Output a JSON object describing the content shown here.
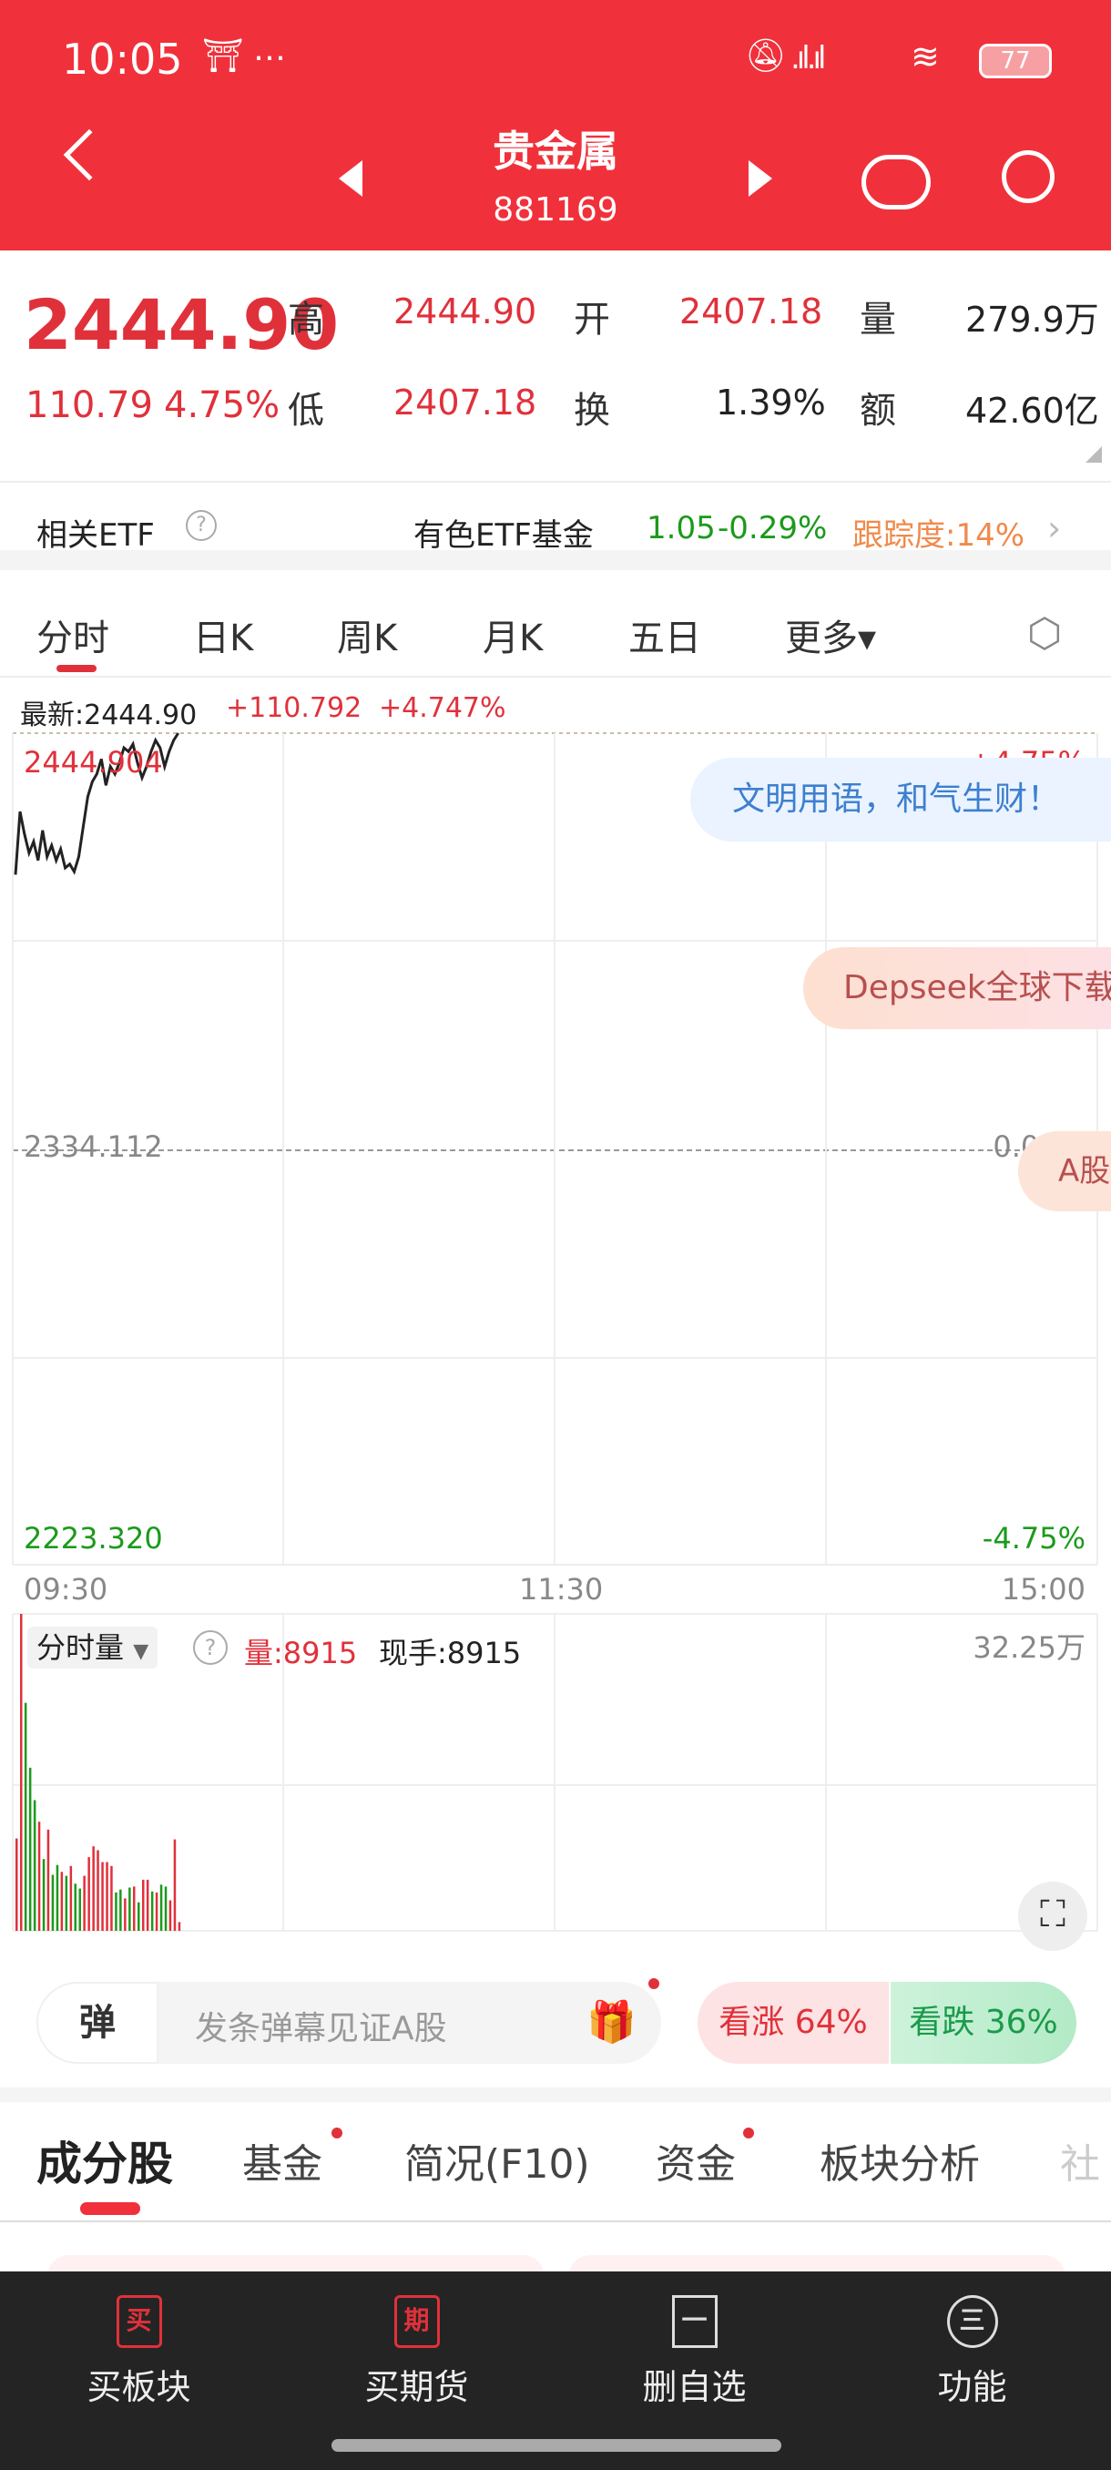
{
  "status_bar": {
    "time": "10:05",
    "extra": "…",
    "battery": "77"
  },
  "header": {
    "title": "贵金属",
    "code": "881169",
    "icons": [
      "back-icon",
      "prev-icon",
      "next-icon",
      "robot-icon",
      "search-icon"
    ]
  },
  "quote": {
    "price": "2444.90",
    "change": "110.79",
    "change_pct": "4.75%",
    "high_label": "高",
    "high": "2444.90",
    "open_label": "开",
    "open": "2407.18",
    "vol_label": "量",
    "vol": "279.9万",
    "low_label": "低",
    "low": "2407.18",
    "turnover_label": "换",
    "turnover": "1.39%",
    "amount_label": "额",
    "amount": "42.60亿"
  },
  "etf": {
    "label": "相关ETF",
    "name": "有色ETF基金",
    "price": "1.05",
    "change": "-0.29%",
    "tracking": "跟踪度:14%"
  },
  "chart_tabs": [
    {
      "label": "分时"
    },
    {
      "label": "日K"
    },
    {
      "label": "周K"
    },
    {
      "label": "月K"
    },
    {
      "label": "五日"
    },
    {
      "label": "更多▾"
    }
  ],
  "chart_info": {
    "latest": "最新:2444.90",
    "change": "+110.792",
    "pct": "+4.747%"
  },
  "chart_data": {
    "type": "line",
    "price_axis": {
      "top": "2444.904",
      "mid": "2334.112",
      "bottom": "2223.320",
      "top_pct": "+4.75%",
      "mid_pct": "0.00%",
      "bottom_pct": "-4.75%"
    },
    "ylim": [
      2223.32,
      2444.904
    ],
    "x_ticks": [
      "09:30",
      "11:30",
      "15:00"
    ],
    "minutes_total": 240,
    "price": [
      2407.18,
      2424,
      2418,
      2413,
      2416,
      2411,
      2419,
      2412,
      2415,
      2411,
      2414,
      2409,
      2410,
      2408,
      2412,
      2420,
      2428,
      2432,
      2434,
      2438,
      2431,
      2436,
      2434,
      2437,
      2441,
      2440,
      2442,
      2437,
      2433,
      2436,
      2440,
      2443,
      2441,
      2436,
      2440,
      2443,
      2444.9
    ],
    "volume": {
      "label": "分时量",
      "vol_text": "量:8915",
      "hand_text": "现手:8915",
      "max_label": "32.25万",
      "max": 322500,
      "values": [
        94000,
        322500,
        232000,
        166000,
        133000,
        111000,
        73000,
        103000,
        57000,
        67000,
        60000,
        56000,
        66000,
        48000,
        43000,
        56000,
        75000,
        86000,
        82000,
        70000,
        70000,
        66000,
        39000,
        42000,
        33000,
        44000,
        45000,
        29000,
        52000,
        52000,
        40000,
        39000,
        47000,
        45000,
        31000,
        93000,
        8915
      ],
      "colors": [
        "r",
        "r",
        "g",
        "g",
        "g",
        "r",
        "g",
        "r",
        "g",
        "g",
        "r",
        "g",
        "r",
        "g",
        "g",
        "r",
        "r",
        "r",
        "r",
        "r",
        "r",
        "r",
        "g",
        "g",
        "r",
        "g",
        "r",
        "g",
        "r",
        "r",
        "g",
        "r",
        "g",
        "g",
        "r",
        "r",
        "r"
      ]
    }
  },
  "bubbles": [
    "文明用语，和气生财！",
    "Depseek全球下载",
    "A股"
  ],
  "danmu": {
    "badge": "弹",
    "placeholder": "发条弹幕见证A股",
    "bull": "看涨 64%",
    "bear": "看跌 36%"
  },
  "section_tabs": [
    {
      "label": "成分股"
    },
    {
      "label": "基金"
    },
    {
      "label": "简况(F10)"
    },
    {
      "label": "资金"
    },
    {
      "label": "板块分析"
    },
    {
      "label": "社"
    }
  ],
  "bottom_nav": [
    {
      "icon": "买",
      "label": "买板块"
    },
    {
      "icon": "期",
      "label": "买期货"
    },
    {
      "icon": "一",
      "label": "删自选"
    },
    {
      "icon": "三",
      "label": "功能"
    }
  ],
  "colors": {
    "brand": "#f0313b",
    "up": "#e0313b",
    "down": "#1b9a1b"
  }
}
